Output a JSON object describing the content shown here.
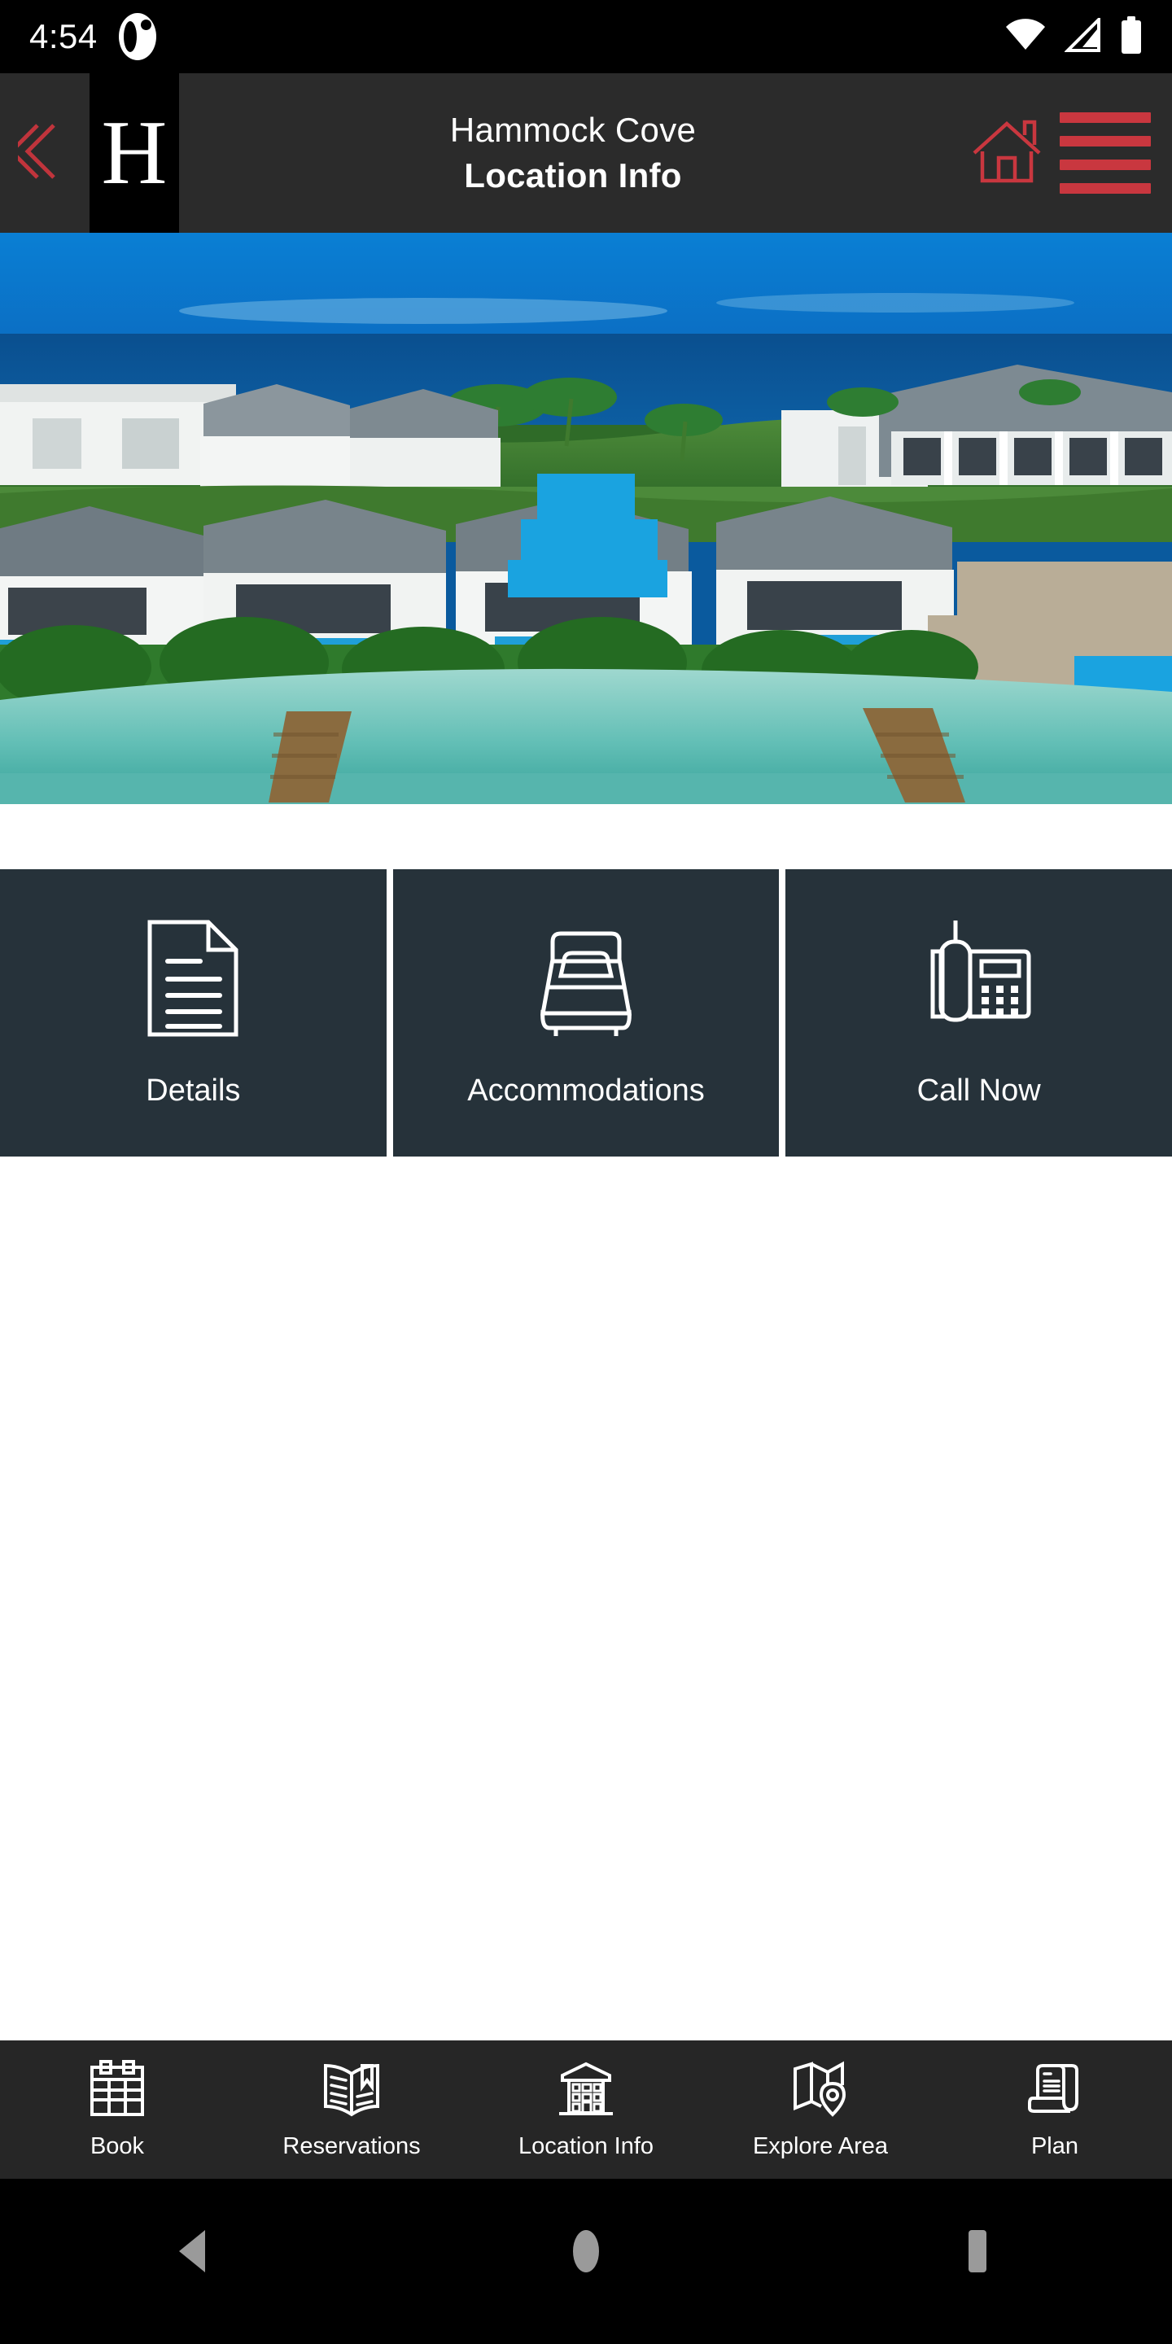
{
  "status_bar": {
    "time": "4:54",
    "icons": [
      "app-notification-icon",
      "wifi-icon",
      "cellular-signal-icon",
      "battery-icon"
    ]
  },
  "header": {
    "back_icon": "back-double-chevron-icon",
    "logo_letter": "H",
    "property_name": "Hammock Cove",
    "page_title": "Location Info",
    "home_icon": "home-icon",
    "menu_icon": "hamburger-menu-icon",
    "accent_color": "#c9373f",
    "background_color": "#2b2b2b"
  },
  "hero": {
    "alt": "Aerial view of beachfront resort villas with pool and piers"
  },
  "tiles": {
    "background_color": "#26323a",
    "items": [
      {
        "label": "Details",
        "icon": "document-icon"
      },
      {
        "label": "Accommodations",
        "icon": "bed-icon"
      },
      {
        "label": "Call Now",
        "icon": "desk-phone-icon"
      }
    ]
  },
  "bottom_nav": {
    "background_color": "#262626",
    "items": [
      {
        "label": "Book",
        "icon": "calendar-icon"
      },
      {
        "label": "Reservations",
        "icon": "open-book-icon"
      },
      {
        "label": "Location Info",
        "icon": "building-icon"
      },
      {
        "label": "Explore Area",
        "icon": "map-pin-icon"
      },
      {
        "label": "Plan",
        "icon": "scroll-itinerary-icon"
      }
    ]
  },
  "android_nav": {
    "items": [
      {
        "icon": "android-back-icon"
      },
      {
        "icon": "android-home-icon"
      },
      {
        "icon": "android-recents-icon"
      }
    ]
  }
}
